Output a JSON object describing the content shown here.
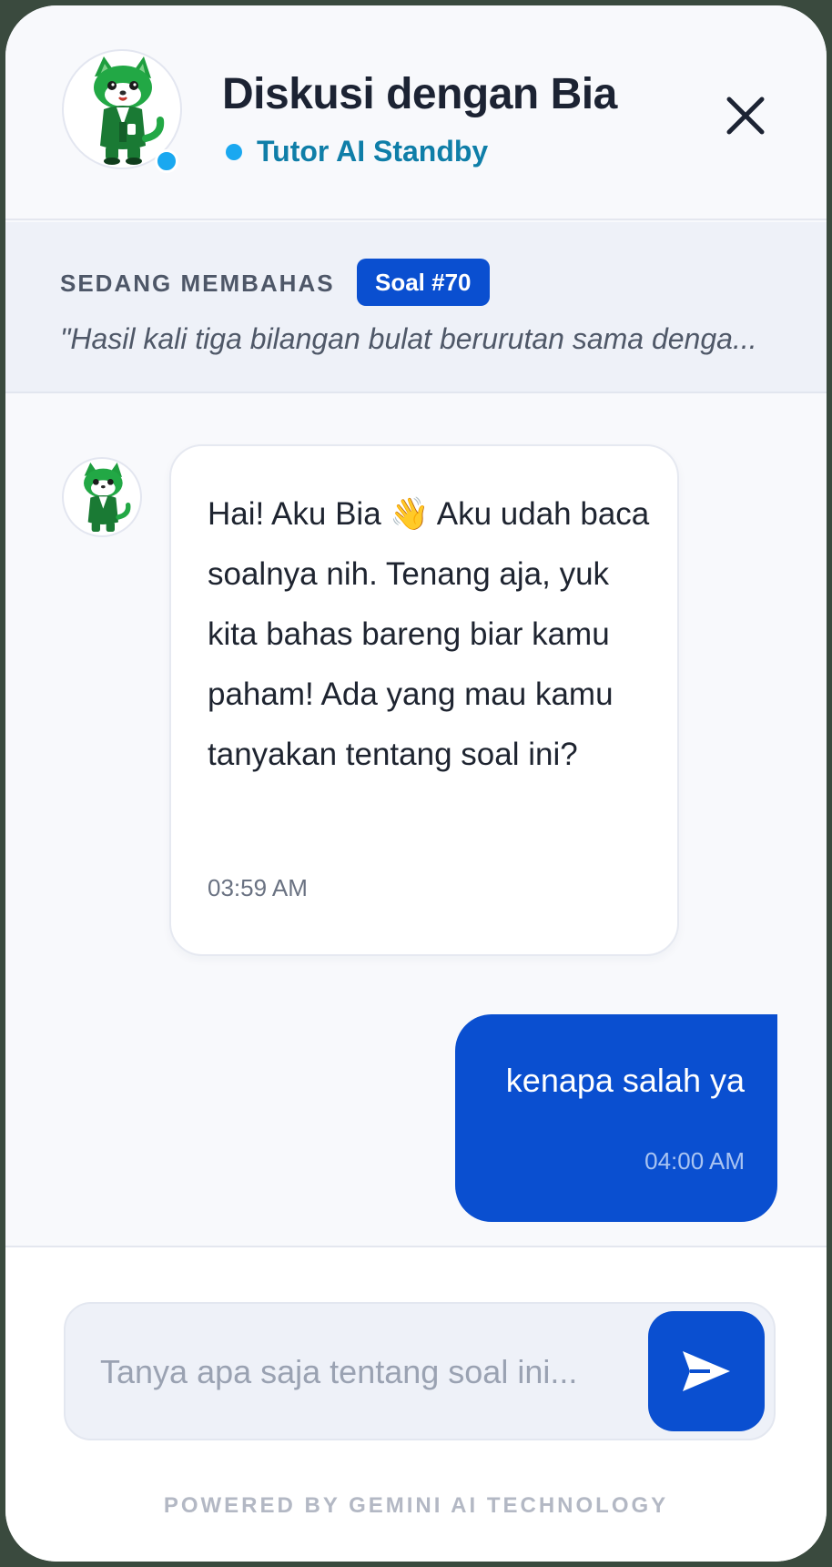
{
  "header": {
    "title": "Diskusi dengan Bia",
    "status": "Tutor AI Standby",
    "avatar_icon": "cat-mascot-icon",
    "close_icon": "close-icon"
  },
  "context": {
    "label": "SEDANG MEMBAHAS",
    "badge": "Soal #70",
    "quote": "\"Hasil kali tiga bilangan bulat berurutan sama denga..."
  },
  "messages": [
    {
      "sender": "bot",
      "text": "Hai! Aku Bia 👋 Aku udah baca soalnya nih. Tenang aja, yuk kita bahas bareng biar kamu paham! Ada yang mau kamu tanyakan tentang soal ini?",
      "time": "03:59 AM"
    },
    {
      "sender": "user",
      "text": "kenapa salah ya",
      "time": "04:00 AM"
    }
  ],
  "composer": {
    "placeholder": "Tanya apa saja tentang soal ini...",
    "send_icon": "send-icon"
  },
  "footer": "POWERED BY GEMINI AI TECHNOLOGY",
  "colors": {
    "primary": "#0a4fd0",
    "status": "#1aa8f0",
    "status_text": "#0f7ea8",
    "mascot": "#1f9e3f"
  }
}
